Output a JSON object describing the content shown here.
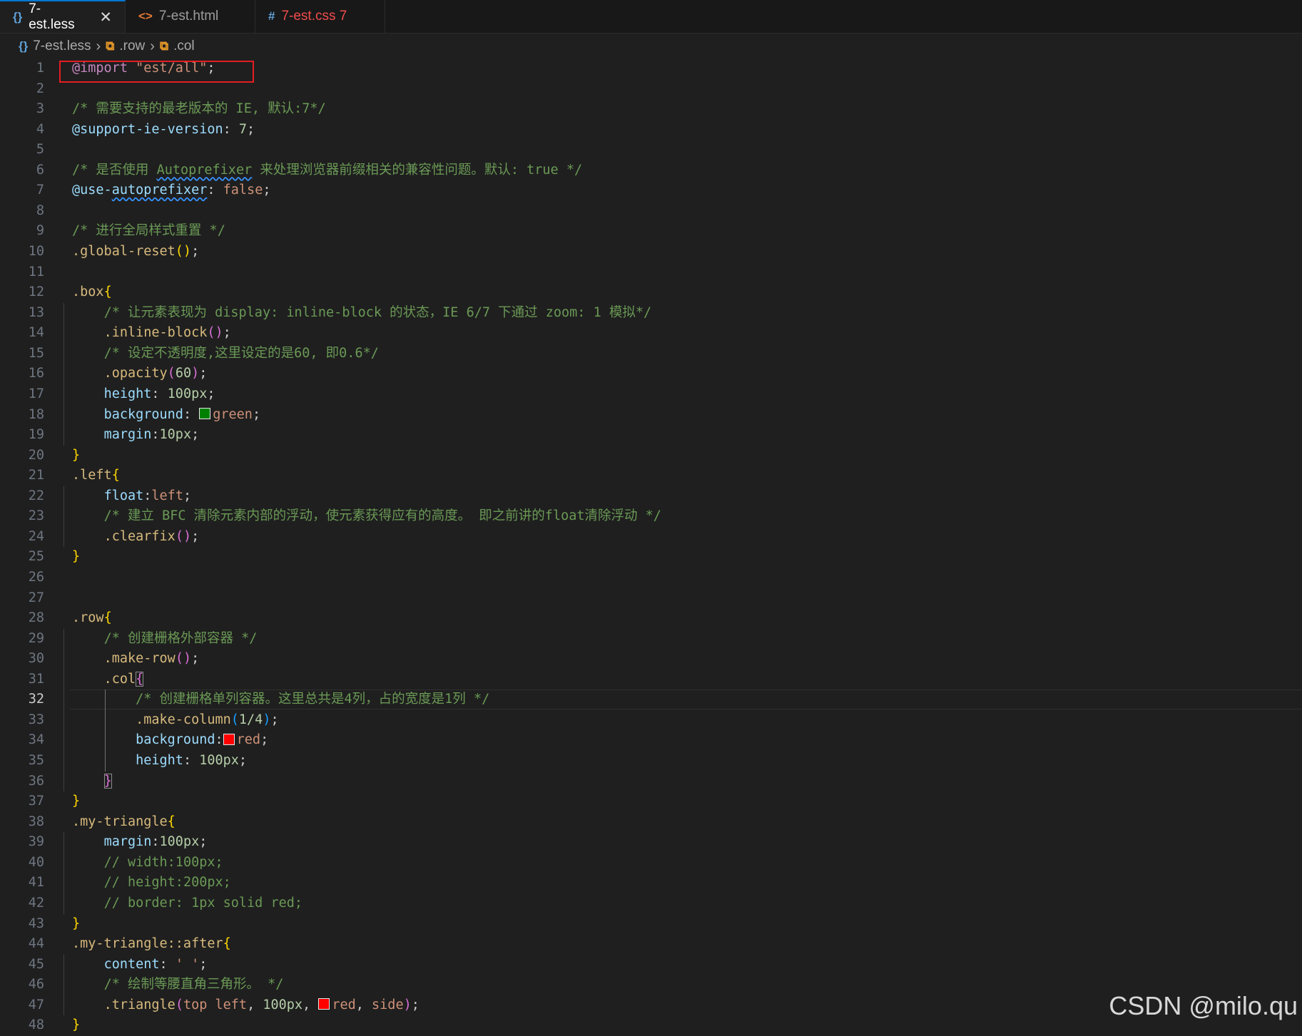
{
  "tabs": [
    {
      "icon": "{}",
      "label": "7-est.less",
      "close": "✕"
    },
    {
      "icon": "<>",
      "label": "7-est.html"
    },
    {
      "icon": "#",
      "label": "7-est.css 7"
    }
  ],
  "breadcrumb": {
    "file_icon": "{}",
    "file": "7-est.less",
    "sep1": "›",
    "sym1_icon": "⧉",
    "sym1": ".row",
    "sep2": "›",
    "sym2_icon": "⧉",
    "sym2": ".col"
  },
  "editor": {
    "current_line": 32,
    "lines": [
      {
        "n": "1",
        "t": [
          [
            "kw",
            "@import"
          ],
          [
            "pun",
            " "
          ],
          [
            "str",
            "\"est/all\""
          ],
          [
            "pun",
            ";"
          ]
        ]
      },
      {
        "n": "2",
        "t": []
      },
      {
        "n": "3",
        "t": [
          [
            "com",
            "/* 需要支持的最老版本的 IE, 默认:7*/"
          ]
        ]
      },
      {
        "n": "4",
        "t": [
          [
            "var",
            "@support-ie-version"
          ],
          [
            "pun",
            ": "
          ],
          [
            "num",
            "7"
          ],
          [
            "pun",
            ";"
          ]
        ]
      },
      {
        "n": "5",
        "t": []
      },
      {
        "n": "6",
        "t": [
          [
            "com",
            "/* 是否使用 "
          ],
          [
            "com",
            "Autoprefixer",
            "sq"
          ],
          [
            "com",
            " 来处理浏览器前缀相关的兼容性问题。默认: true */"
          ]
        ]
      },
      {
        "n": "7",
        "t": [
          [
            "var",
            "@use-"
          ],
          [
            "var",
            "autoprefixer",
            "sq"
          ],
          [
            "pun",
            ": "
          ],
          [
            "val",
            "false"
          ],
          [
            "pun",
            ";"
          ]
        ]
      },
      {
        "n": "8",
        "t": []
      },
      {
        "n": "9",
        "t": [
          [
            "com",
            "/* 进行全局样式重置 */"
          ]
        ]
      },
      {
        "n": "10",
        "t": [
          [
            "sel",
            ".global-reset"
          ],
          [
            "br1",
            "()"
          ],
          [
            "pun",
            ";"
          ]
        ]
      },
      {
        "n": "11",
        "t": []
      },
      {
        "n": "12",
        "t": [
          [
            "sel",
            ".box"
          ],
          [
            "br1",
            "{"
          ]
        ]
      },
      {
        "n": "13",
        "t": [
          [
            "pun",
            "    "
          ],
          [
            "com",
            "/* 让元素表现为 display: inline-block 的状态，IE 6/7 下通过 zoom: 1 模拟*/"
          ]
        ]
      },
      {
        "n": "14",
        "t": [
          [
            "pun",
            "    "
          ],
          [
            "sel",
            ".inline-block"
          ],
          [
            "br2",
            "()"
          ],
          [
            "pun",
            ";"
          ]
        ]
      },
      {
        "n": "15",
        "t": [
          [
            "pun",
            "    "
          ],
          [
            "com",
            "/* 设定不透明度,这里设定的是60, 即0.6*/"
          ]
        ]
      },
      {
        "n": "16",
        "t": [
          [
            "pun",
            "    "
          ],
          [
            "sel",
            ".opacity"
          ],
          [
            "br2",
            "("
          ],
          [
            "num",
            "60"
          ],
          [
            "br2",
            ")"
          ],
          [
            "pun",
            ";"
          ]
        ]
      },
      {
        "n": "17",
        "t": [
          [
            "pun",
            "    "
          ],
          [
            "prop",
            "height"
          ],
          [
            "pun",
            ": "
          ],
          [
            "num",
            "100px"
          ],
          [
            "pun",
            ";"
          ]
        ]
      },
      {
        "n": "18",
        "t": [
          [
            "pun",
            "    "
          ],
          [
            "prop",
            "background"
          ],
          [
            "pun",
            ": "
          ],
          [
            "sw",
            "#008000"
          ],
          [
            "val",
            "green"
          ],
          [
            "pun",
            ";"
          ]
        ]
      },
      {
        "n": "19",
        "t": [
          [
            "pun",
            "    "
          ],
          [
            "prop",
            "margin"
          ],
          [
            "pun",
            ":"
          ],
          [
            "num",
            "10px"
          ],
          [
            "pun",
            ";"
          ]
        ]
      },
      {
        "n": "20",
        "t": [
          [
            "br1",
            "}"
          ]
        ]
      },
      {
        "n": "21",
        "t": [
          [
            "sel",
            ".left"
          ],
          [
            "br1",
            "{"
          ]
        ]
      },
      {
        "n": "22",
        "t": [
          [
            "pun",
            "    "
          ],
          [
            "prop",
            "float"
          ],
          [
            "pun",
            ":"
          ],
          [
            "val",
            "left"
          ],
          [
            "pun",
            ";"
          ]
        ]
      },
      {
        "n": "23",
        "t": [
          [
            "pun",
            "    "
          ],
          [
            "com",
            "/* 建立 BFC 清除元素内部的浮动，使元素获得应有的高度。 即之前讲的float清除浮动 */"
          ]
        ]
      },
      {
        "n": "24",
        "t": [
          [
            "pun",
            "    "
          ],
          [
            "sel",
            ".clearfix"
          ],
          [
            "br2",
            "()"
          ],
          [
            "pun",
            ";"
          ]
        ]
      },
      {
        "n": "25",
        "t": [
          [
            "br1",
            "}"
          ]
        ]
      },
      {
        "n": "26",
        "t": []
      },
      {
        "n": "27",
        "t": []
      },
      {
        "n": "28",
        "t": [
          [
            "sel",
            ".row"
          ],
          [
            "br1",
            "{"
          ]
        ]
      },
      {
        "n": "29",
        "t": [
          [
            "pun",
            "    "
          ],
          [
            "com",
            "/* 创建栅格外部容器 */"
          ]
        ]
      },
      {
        "n": "30",
        "t": [
          [
            "pun",
            "    "
          ],
          [
            "sel",
            ".make-row"
          ],
          [
            "br2",
            "()"
          ],
          [
            "pun",
            ";"
          ]
        ]
      },
      {
        "n": "31",
        "t": [
          [
            "pun",
            "    "
          ],
          [
            "sel",
            ".col"
          ],
          [
            "br2",
            "{",
            "bx"
          ]
        ]
      },
      {
        "n": "32",
        "t": [
          [
            "pun",
            "        "
          ],
          [
            "com",
            "/* 创建栅格单列容器。这里总共是4列，占的宽度是1列 */"
          ]
        ]
      },
      {
        "n": "33",
        "t": [
          [
            "pun",
            "        "
          ],
          [
            "sel",
            ".make-column"
          ],
          [
            "br3",
            "("
          ],
          [
            "num",
            "1/4"
          ],
          [
            "br3",
            ")"
          ],
          [
            "pun",
            ";"
          ]
        ]
      },
      {
        "n": "34",
        "t": [
          [
            "pun",
            "        "
          ],
          [
            "prop",
            "background"
          ],
          [
            "pun",
            ":"
          ],
          [
            "sw",
            "#ff0000"
          ],
          [
            "val",
            "red"
          ],
          [
            "pun",
            ";"
          ]
        ]
      },
      {
        "n": "35",
        "t": [
          [
            "pun",
            "        "
          ],
          [
            "prop",
            "height"
          ],
          [
            "pun",
            ": "
          ],
          [
            "num",
            "100px"
          ],
          [
            "pun",
            ";"
          ]
        ]
      },
      {
        "n": "36",
        "t": [
          [
            "pun",
            "    "
          ],
          [
            "br2",
            "}",
            "bx"
          ]
        ]
      },
      {
        "n": "37",
        "t": [
          [
            "br1",
            "}"
          ]
        ]
      },
      {
        "n": "38",
        "t": [
          [
            "sel",
            ".my-triangle"
          ],
          [
            "br1",
            "{"
          ]
        ]
      },
      {
        "n": "39",
        "t": [
          [
            "pun",
            "    "
          ],
          [
            "prop",
            "margin"
          ],
          [
            "pun",
            ":"
          ],
          [
            "num",
            "100px"
          ],
          [
            "pun",
            ";"
          ]
        ]
      },
      {
        "n": "40",
        "t": [
          [
            "pun",
            "    "
          ],
          [
            "com",
            "// width:100px;"
          ]
        ]
      },
      {
        "n": "41",
        "t": [
          [
            "pun",
            "    "
          ],
          [
            "com",
            "// height:200px;"
          ]
        ]
      },
      {
        "n": "42",
        "t": [
          [
            "pun",
            "    "
          ],
          [
            "com",
            "// border: 1px solid red;"
          ]
        ]
      },
      {
        "n": "43",
        "t": [
          [
            "br1",
            "}"
          ]
        ]
      },
      {
        "n": "44",
        "t": [
          [
            "sel",
            ".my-triangle::after"
          ],
          [
            "br1",
            "{"
          ]
        ]
      },
      {
        "n": "45",
        "t": [
          [
            "pun",
            "    "
          ],
          [
            "prop",
            "content"
          ],
          [
            "pun",
            ": "
          ],
          [
            "val",
            "' '"
          ],
          [
            "pun",
            ";"
          ]
        ]
      },
      {
        "n": "46",
        "t": [
          [
            "pun",
            "    "
          ],
          [
            "com",
            "/* 绘制等腰直角三角形。 */"
          ]
        ]
      },
      {
        "n": "47",
        "t": [
          [
            "pun",
            "    "
          ],
          [
            "sel",
            ".triangle"
          ],
          [
            "br2",
            "("
          ],
          [
            "val",
            "top left"
          ],
          [
            "pun",
            ", "
          ],
          [
            "num",
            "100px"
          ],
          [
            "pun",
            ", "
          ],
          [
            "sw",
            "#ff0000"
          ],
          [
            "val",
            "red"
          ],
          [
            "pun",
            ", "
          ],
          [
            "val",
            "side"
          ],
          [
            "br2",
            ")"
          ],
          [
            "pun",
            ";"
          ]
        ]
      },
      {
        "n": "48",
        "t": [
          [
            "br1",
            "}"
          ]
        ]
      }
    ]
  },
  "watermark": "CSDN @milo.qu",
  "colors": {
    "accent": "#0078d4",
    "error": "#f14c4c",
    "annotation_box": "#e51c23"
  }
}
